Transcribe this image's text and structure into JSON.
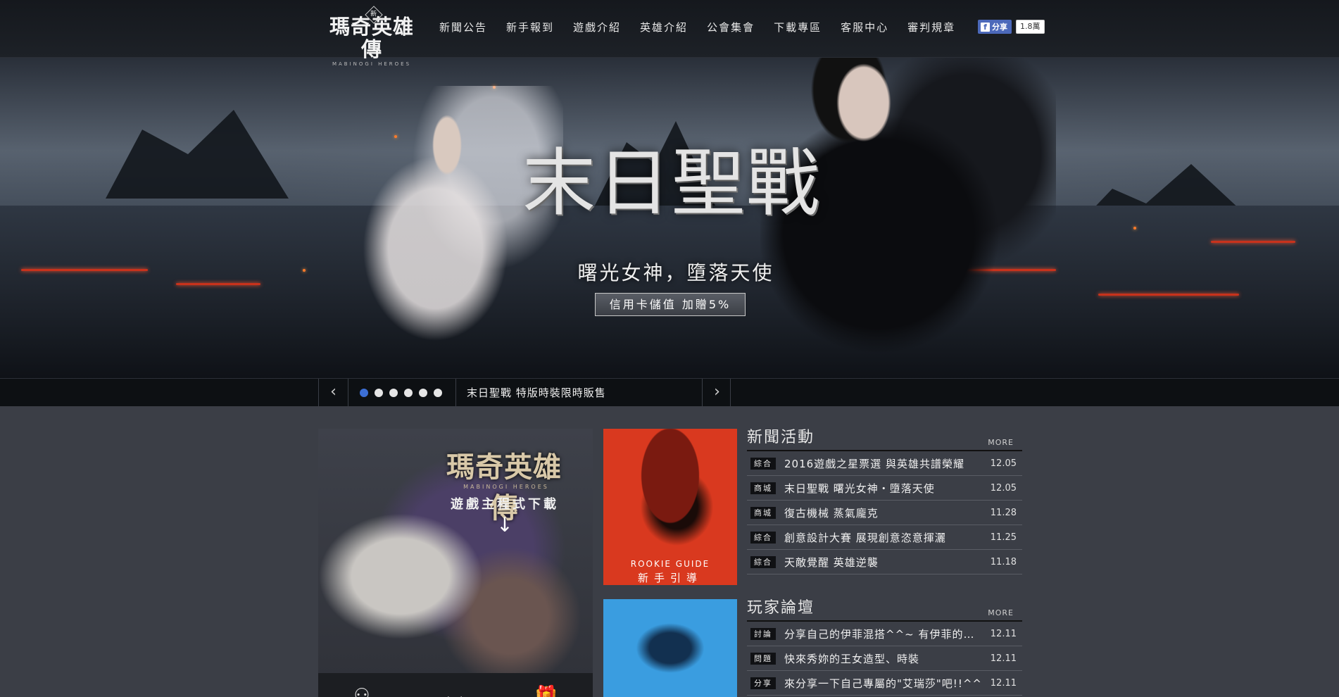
{
  "header": {
    "logo_text": "瑪奇英雄傳",
    "logo_badge": "新",
    "logo_sub": "MABINOGI HEROES",
    "nav": [
      {
        "label": "新聞公告"
      },
      {
        "label": "新手報到"
      },
      {
        "label": "遊戲介紹"
      },
      {
        "label": "英雄介紹"
      },
      {
        "label": "公會集會"
      },
      {
        "label": "下載專區"
      },
      {
        "label": "客服中心"
      },
      {
        "label": "審判規章"
      }
    ],
    "fb_share_label": "分享",
    "fb_icon": "f",
    "fb_count": "1.8萬"
  },
  "hero": {
    "title": "末日聖戰",
    "subtitle": "曙光女神，墮落天使",
    "cta_label": "信用卡儲值 加贈5%"
  },
  "slider": {
    "prev_icon": "‹",
    "next_icon": "›",
    "dot_count": 6,
    "active_dot": 0,
    "caption": "末日聖戰 特版時裝限時販售"
  },
  "download": {
    "logo_text": "瑪奇英雄傳",
    "logo_sub": "MABINOGI HEROES",
    "text": "遊戲主程式下載",
    "arrow_icon": "↓",
    "icons": [
      "user-icon",
      "shell-icon",
      "gift-icon"
    ],
    "icon_glyphs": [
      "⚇",
      "◡",
      "🎁"
    ]
  },
  "cards": {
    "rookie_en": "ROOKIE GUIDE",
    "rookie_zh": "新手引導"
  },
  "news": {
    "title": "新聞活動",
    "more": "MORE",
    "items": [
      {
        "tag": "綜合",
        "title": "2016遊戲之星票選 與英雄共譜榮耀",
        "date": "12.05"
      },
      {
        "tag": "商城",
        "title": "末日聖戰 曙光女神・墮落天使",
        "date": "12.05"
      },
      {
        "tag": "商城",
        "title": "復古機械 蒸氣龐克",
        "date": "11.28"
      },
      {
        "tag": "綜合",
        "title": "創意設計大賽 展現創意恣意揮灑",
        "date": "11.25"
      },
      {
        "tag": "綜合",
        "title": "天敵覺醒 英雄逆襲",
        "date": "11.18"
      }
    ]
  },
  "forum": {
    "title": "玩家論壇",
    "more": "MORE",
    "items": [
      {
        "tag": "討論",
        "title": "分享自己的伊菲混搭^^~ 有伊菲的人...",
        "date": "12.11"
      },
      {
        "tag": "問題",
        "title": "快來秀妳的王女造型、時裝",
        "date": "12.11"
      },
      {
        "tag": "分享",
        "title": "來分享一下自己專屬的\"艾瑞莎\"吧!!^^",
        "date": "12.11"
      }
    ]
  }
}
